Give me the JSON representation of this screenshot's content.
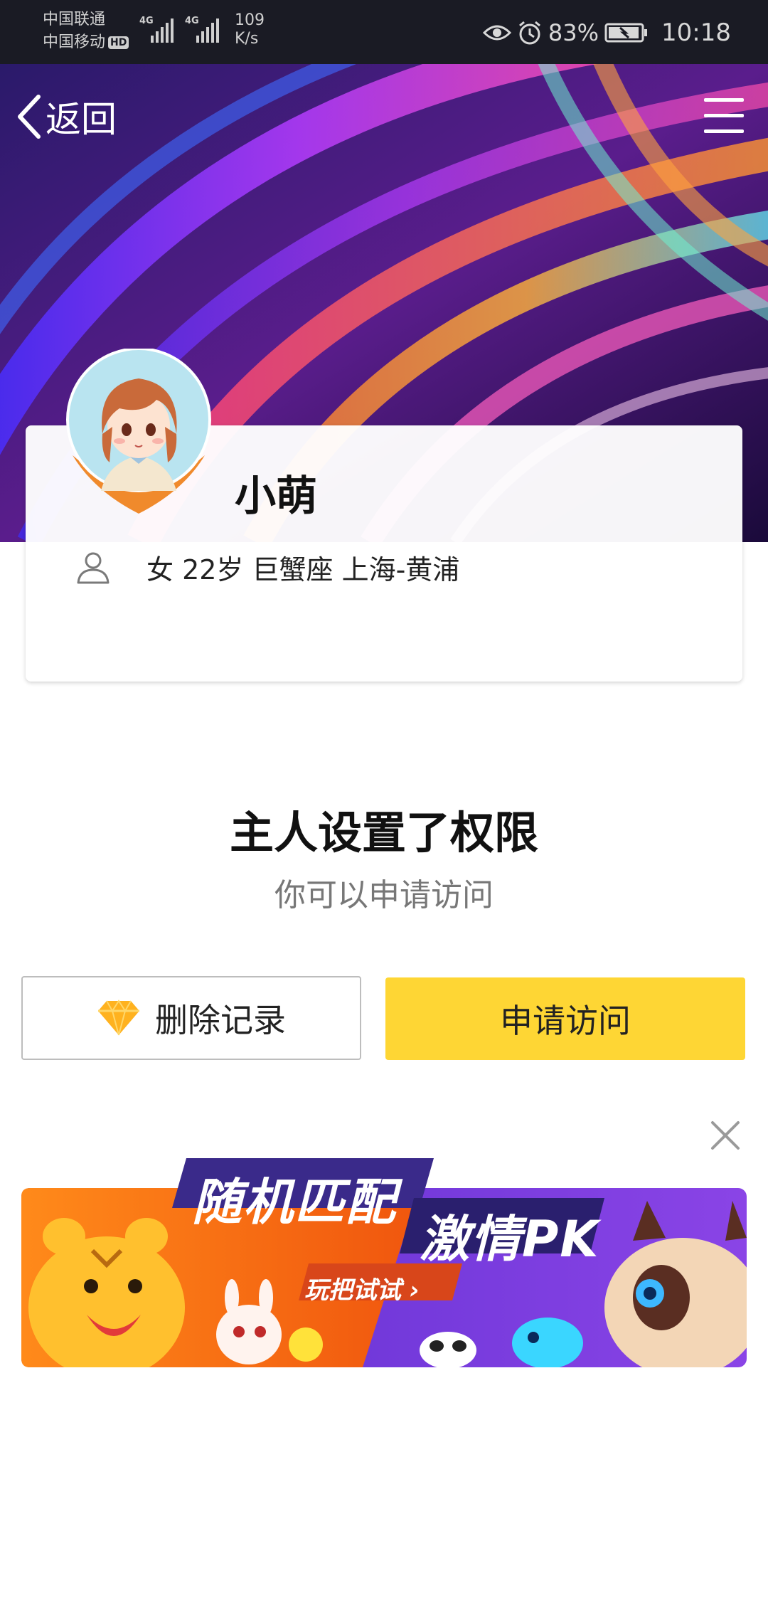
{
  "status_bar": {
    "carrier_1": "中国联通",
    "carrier_2": "中国移动",
    "hd_badge": "HD",
    "network_1": "4G",
    "network_2": "4G",
    "speed_value": "109",
    "speed_unit": "K/s",
    "battery_percent": "83%",
    "time": "10:18"
  },
  "header": {
    "back_label": "返回"
  },
  "profile": {
    "nickname": "小萌",
    "info": "女 22岁 巨蟹座 上海-黄浦"
  },
  "permission": {
    "title": "主人设置了权限",
    "subtitle": "你可以申请访问"
  },
  "actions": {
    "delete_label": "删除记录",
    "apply_label": "申请访问"
  },
  "ad": {
    "title_part_1": "随机匹配",
    "title_part_2": "激情PK",
    "cta": "玩把试试 ›"
  },
  "colors": {
    "status_bar_bg": "#1a1b24",
    "apply_button": "#fed634",
    "subtitle_text": "#777777",
    "ad_left": "#f47a12",
    "ad_right": "#7a3ad8"
  },
  "icons": {
    "back": "chevron-left-icon",
    "menu": "hamburger-menu-icon",
    "person": "person-outline-icon",
    "diamond": "diamond-icon",
    "close": "close-icon",
    "eye": "eye-icon",
    "alarm": "alarm-icon",
    "battery": "battery-charging-icon"
  }
}
